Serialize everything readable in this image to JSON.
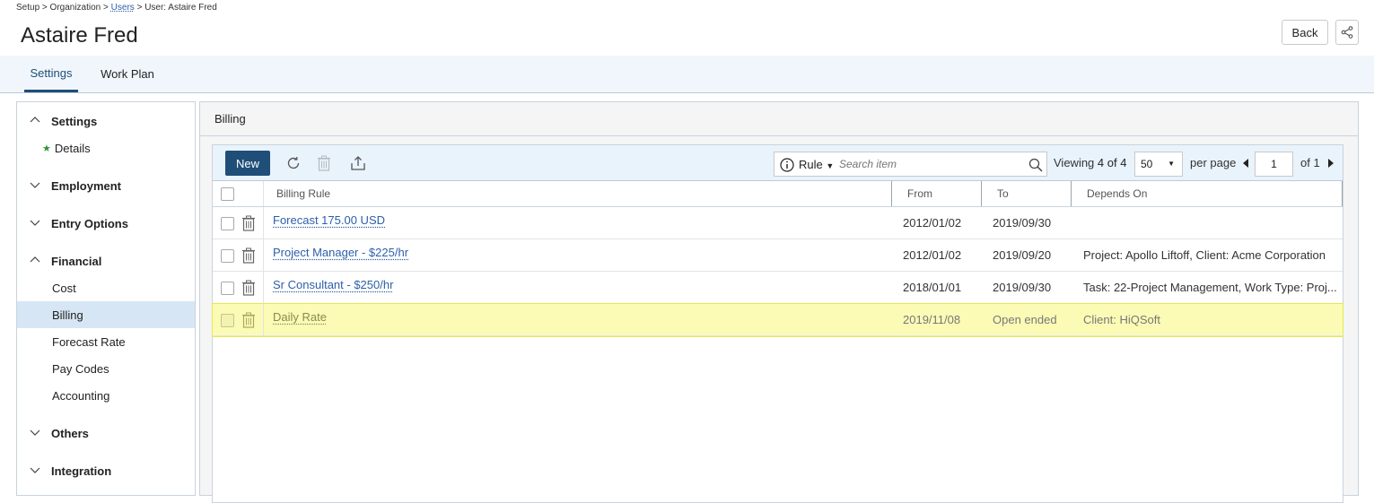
{
  "breadcrumb": {
    "setup": "Setup",
    "sep1": ">",
    "organization": "Organization",
    "sep2": ">",
    "users": "Users",
    "sep3": ">",
    "current": "User: Astaire Fred"
  },
  "header": {
    "title": "Astaire Fred",
    "back_label": "Back"
  },
  "tabs": [
    {
      "label": "Settings",
      "active": true
    },
    {
      "label": "Work Plan",
      "active": false
    }
  ],
  "sidebar": {
    "groups": [
      {
        "label": "Settings",
        "expanded": true,
        "items": [
          {
            "label": "Details",
            "starred": true
          }
        ]
      },
      {
        "label": "Employment",
        "expanded": false,
        "items": []
      },
      {
        "label": "Entry Options",
        "expanded": false,
        "items": []
      },
      {
        "label": "Financial",
        "expanded": true,
        "items": [
          {
            "label": "Cost"
          },
          {
            "label": "Billing",
            "active": true
          },
          {
            "label": "Forecast Rate"
          },
          {
            "label": "Pay Codes"
          },
          {
            "label": "Accounting"
          }
        ]
      },
      {
        "label": "Others",
        "expanded": false,
        "items": []
      },
      {
        "label": "Integration",
        "expanded": false,
        "items": []
      }
    ]
  },
  "main": {
    "section_title": "Billing",
    "toolbar": {
      "new_label": "New",
      "search_filter": "Rule",
      "search_placeholder": "Search item",
      "viewing_label": "Viewing",
      "viewing_count": "4 of 4",
      "per_page_value": "50",
      "per_page_label": "per page",
      "page_value": "1",
      "page_of": "of 1"
    },
    "columns": {
      "rule": "Billing Rule",
      "from": "From",
      "to": "To",
      "depends": "Depends On"
    },
    "rows": [
      {
        "rule": "Forecast 175.00 USD",
        "from": "2012/01/02",
        "to": "2019/09/30",
        "depends": "",
        "highlight": false
      },
      {
        "rule": "Project Manager - $225/hr",
        "from": "2012/01/02",
        "to": "2019/09/20",
        "depends": "Project: Apollo Liftoff, Client: Acme Corporation",
        "highlight": false
      },
      {
        "rule": "Sr Consultant - $250/hr",
        "from": "2018/01/01",
        "to": "2019/09/30",
        "depends": "Task: 22-Project Management, Work Type: Proj...",
        "highlight": false
      },
      {
        "rule": "Daily Rate",
        "from": "2019/11/08",
        "to": "Open ended",
        "depends": "Client: HiQSoft",
        "highlight": true
      }
    ]
  },
  "colors": {
    "accent": "#1f4e79",
    "link": "#2d5fa8",
    "highlight": "#fbfbb6",
    "sidebar_active": "#d7e6f4"
  }
}
